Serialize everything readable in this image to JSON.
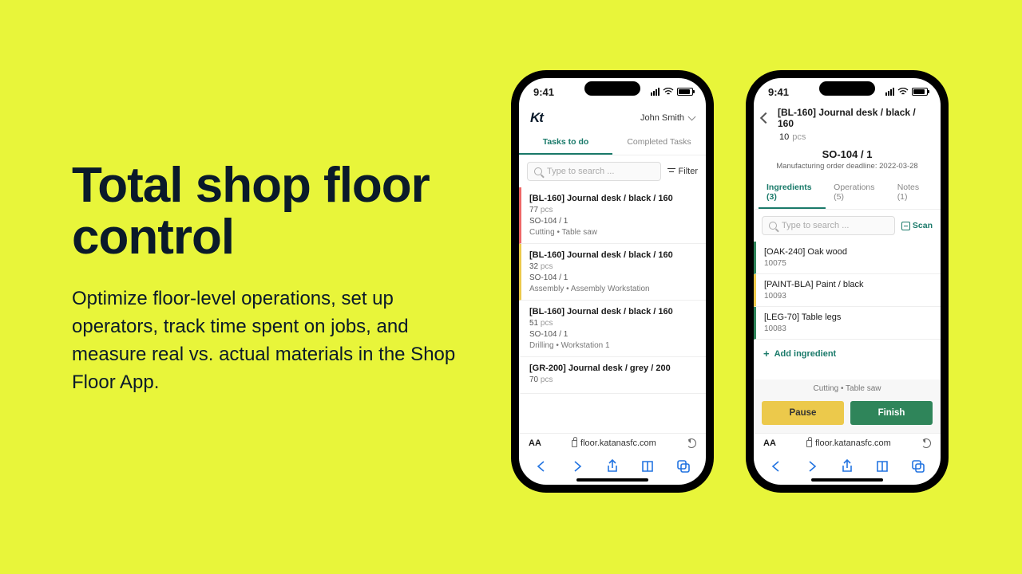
{
  "hero": {
    "title": "Total shop floor control",
    "body": "Optimize floor-level operations, set up operators, track time spent on jobs, and measure real vs. actual materials in the Shop Floor App."
  },
  "status_time": "9:41",
  "browser_url": "floor.katanasfc.com",
  "phone1": {
    "logo": "Kt",
    "user_name": "John Smith",
    "tabs": {
      "todo": "Tasks to do",
      "done": "Completed Tasks"
    },
    "search_placeholder": "Type to search ...",
    "filter_label": "Filter",
    "tasks": [
      {
        "title": "[BL-160] Journal desk / black / 160",
        "qty": "77",
        "unit": "pcs",
        "so": "SO-104 / 1",
        "ops": "Cutting  •  Table saw",
        "accent": "red"
      },
      {
        "title": "[BL-160] Journal desk / black / 160",
        "qty": "32",
        "unit": "pcs",
        "so": "SO-104 / 1",
        "ops": "Assembly  •  Assembly Workstation",
        "accent": "yellow"
      },
      {
        "title": "[BL-160] Journal desk / black / 160",
        "qty": "51",
        "unit": "pcs",
        "so": "SO-104 / 1",
        "ops": "Drilling  •  Workstation 1",
        "accent": ""
      },
      {
        "title": "[GR-200] Journal desk / grey / 200",
        "qty": "70",
        "unit": "pcs",
        "so": "",
        "ops": "",
        "accent": ""
      }
    ]
  },
  "phone2": {
    "title": "[BL-160] Journal desk / black / 160",
    "qty": "10",
    "unit": "pcs",
    "so": "SO-104 / 1",
    "deadline": "Manufacturing order deadline: 2022-03-28",
    "tabs": {
      "ing": "Ingredients (3)",
      "ops": "Operations (5)",
      "notes": "Notes (1)"
    },
    "search_placeholder": "Type to search ...",
    "scan_label": "Scan",
    "ingredients": [
      {
        "name": "[OAK-240] Oak wood",
        "code": "10075",
        "accent": "green"
      },
      {
        "name": "[PAINT-BLA] Paint / black",
        "code": "10093",
        "accent": "yellow"
      },
      {
        "name": "[LEG-70] Table legs",
        "code": "10083",
        "accent": "green"
      }
    ],
    "add_label": "Add ingredient",
    "bottom_ops": "Cutting  •  Table saw",
    "pause_label": "Pause",
    "finish_label": "Finish"
  }
}
